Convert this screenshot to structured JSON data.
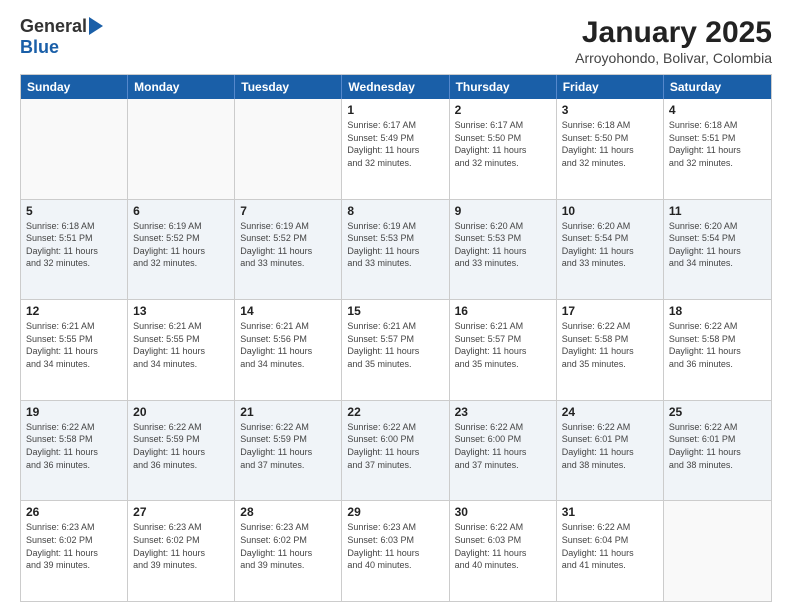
{
  "header": {
    "logo_general": "General",
    "logo_blue": "Blue",
    "month_title": "January 2025",
    "location": "Arroyohondo, Bolivar, Colombia"
  },
  "days_of_week": [
    "Sunday",
    "Monday",
    "Tuesday",
    "Wednesday",
    "Thursday",
    "Friday",
    "Saturday"
  ],
  "weeks": [
    [
      {
        "day": "",
        "info": ""
      },
      {
        "day": "",
        "info": ""
      },
      {
        "day": "",
        "info": ""
      },
      {
        "day": "1",
        "info": "Sunrise: 6:17 AM\nSunset: 5:49 PM\nDaylight: 11 hours\nand 32 minutes."
      },
      {
        "day": "2",
        "info": "Sunrise: 6:17 AM\nSunset: 5:50 PM\nDaylight: 11 hours\nand 32 minutes."
      },
      {
        "day": "3",
        "info": "Sunrise: 6:18 AM\nSunset: 5:50 PM\nDaylight: 11 hours\nand 32 minutes."
      },
      {
        "day": "4",
        "info": "Sunrise: 6:18 AM\nSunset: 5:51 PM\nDaylight: 11 hours\nand 32 minutes."
      }
    ],
    [
      {
        "day": "5",
        "info": "Sunrise: 6:18 AM\nSunset: 5:51 PM\nDaylight: 11 hours\nand 32 minutes."
      },
      {
        "day": "6",
        "info": "Sunrise: 6:19 AM\nSunset: 5:52 PM\nDaylight: 11 hours\nand 32 minutes."
      },
      {
        "day": "7",
        "info": "Sunrise: 6:19 AM\nSunset: 5:52 PM\nDaylight: 11 hours\nand 33 minutes."
      },
      {
        "day": "8",
        "info": "Sunrise: 6:19 AM\nSunset: 5:53 PM\nDaylight: 11 hours\nand 33 minutes."
      },
      {
        "day": "9",
        "info": "Sunrise: 6:20 AM\nSunset: 5:53 PM\nDaylight: 11 hours\nand 33 minutes."
      },
      {
        "day": "10",
        "info": "Sunrise: 6:20 AM\nSunset: 5:54 PM\nDaylight: 11 hours\nand 33 minutes."
      },
      {
        "day": "11",
        "info": "Sunrise: 6:20 AM\nSunset: 5:54 PM\nDaylight: 11 hours\nand 34 minutes."
      }
    ],
    [
      {
        "day": "12",
        "info": "Sunrise: 6:21 AM\nSunset: 5:55 PM\nDaylight: 11 hours\nand 34 minutes."
      },
      {
        "day": "13",
        "info": "Sunrise: 6:21 AM\nSunset: 5:55 PM\nDaylight: 11 hours\nand 34 minutes."
      },
      {
        "day": "14",
        "info": "Sunrise: 6:21 AM\nSunset: 5:56 PM\nDaylight: 11 hours\nand 34 minutes."
      },
      {
        "day": "15",
        "info": "Sunrise: 6:21 AM\nSunset: 5:57 PM\nDaylight: 11 hours\nand 35 minutes."
      },
      {
        "day": "16",
        "info": "Sunrise: 6:21 AM\nSunset: 5:57 PM\nDaylight: 11 hours\nand 35 minutes."
      },
      {
        "day": "17",
        "info": "Sunrise: 6:22 AM\nSunset: 5:58 PM\nDaylight: 11 hours\nand 35 minutes."
      },
      {
        "day": "18",
        "info": "Sunrise: 6:22 AM\nSunset: 5:58 PM\nDaylight: 11 hours\nand 36 minutes."
      }
    ],
    [
      {
        "day": "19",
        "info": "Sunrise: 6:22 AM\nSunset: 5:58 PM\nDaylight: 11 hours\nand 36 minutes."
      },
      {
        "day": "20",
        "info": "Sunrise: 6:22 AM\nSunset: 5:59 PM\nDaylight: 11 hours\nand 36 minutes."
      },
      {
        "day": "21",
        "info": "Sunrise: 6:22 AM\nSunset: 5:59 PM\nDaylight: 11 hours\nand 37 minutes."
      },
      {
        "day": "22",
        "info": "Sunrise: 6:22 AM\nSunset: 6:00 PM\nDaylight: 11 hours\nand 37 minutes."
      },
      {
        "day": "23",
        "info": "Sunrise: 6:22 AM\nSunset: 6:00 PM\nDaylight: 11 hours\nand 37 minutes."
      },
      {
        "day": "24",
        "info": "Sunrise: 6:22 AM\nSunset: 6:01 PM\nDaylight: 11 hours\nand 38 minutes."
      },
      {
        "day": "25",
        "info": "Sunrise: 6:22 AM\nSunset: 6:01 PM\nDaylight: 11 hours\nand 38 minutes."
      }
    ],
    [
      {
        "day": "26",
        "info": "Sunrise: 6:23 AM\nSunset: 6:02 PM\nDaylight: 11 hours\nand 39 minutes."
      },
      {
        "day": "27",
        "info": "Sunrise: 6:23 AM\nSunset: 6:02 PM\nDaylight: 11 hours\nand 39 minutes."
      },
      {
        "day": "28",
        "info": "Sunrise: 6:23 AM\nSunset: 6:02 PM\nDaylight: 11 hours\nand 39 minutes."
      },
      {
        "day": "29",
        "info": "Sunrise: 6:23 AM\nSunset: 6:03 PM\nDaylight: 11 hours\nand 40 minutes."
      },
      {
        "day": "30",
        "info": "Sunrise: 6:22 AM\nSunset: 6:03 PM\nDaylight: 11 hours\nand 40 minutes."
      },
      {
        "day": "31",
        "info": "Sunrise: 6:22 AM\nSunset: 6:04 PM\nDaylight: 11 hours\nand 41 minutes."
      },
      {
        "day": "",
        "info": ""
      }
    ]
  ]
}
